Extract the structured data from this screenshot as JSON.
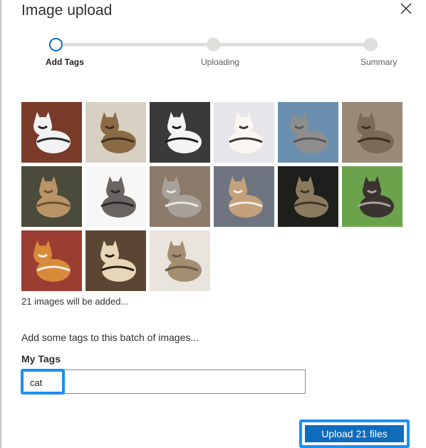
{
  "dialog": {
    "title": "Image upload"
  },
  "stepper": {
    "steps": [
      {
        "label": "Add Tags",
        "active": true
      },
      {
        "label": "Uploading",
        "active": false
      },
      {
        "label": "Summary",
        "active": false
      }
    ]
  },
  "images": {
    "count_text": "21 images will be added...",
    "thumbnails": [
      {
        "name": "thumb-1",
        "bg": "#7a3b2a",
        "fg": "#f2f2f2",
        "accent": "#2a2a2a"
      },
      {
        "name": "thumb-2",
        "bg": "#d8d0c2",
        "fg": "#8b6b45",
        "accent": "#3b2f23"
      },
      {
        "name": "thumb-3",
        "bg": "#3a3a3a",
        "fg": "#f4f4f4",
        "accent": "#1a1a1a"
      },
      {
        "name": "thumb-4",
        "bg": "#e5e5ea",
        "fg": "#fbf7f0",
        "accent": "#3a3a3a"
      },
      {
        "name": "thumb-5",
        "bg": "#6b8fae",
        "fg": "#8e8e8e",
        "accent": "#585858"
      },
      {
        "name": "thumb-6",
        "bg": "#9a8a78",
        "fg": "#7b6a55",
        "accent": "#3b3024"
      },
      {
        "name": "thumb-7",
        "bg": "#4a4b3a",
        "fg": "#b89466",
        "accent": "#6b5335"
      },
      {
        "name": "thumb-8",
        "bg": "#f7f7f7",
        "fg": "#6a6563",
        "accent": "#2b2a2a"
      },
      {
        "name": "thumb-9",
        "bg": "#8c7a6a",
        "fg": "#a7a19a",
        "accent": "#e9e6e1"
      },
      {
        "name": "thumb-10",
        "bg": "#6f7580",
        "fg": "#c4a17a",
        "accent": "#f1ede6"
      },
      {
        "name": "thumb-11",
        "bg": "#1d1f1d",
        "fg": "#8b7a5e",
        "accent": "#3b3528"
      },
      {
        "name": "thumb-12",
        "bg": "#6aa34c",
        "fg": "#3a3330",
        "accent": "#a9a39e"
      },
      {
        "name": "thumb-13",
        "bg": "#9a3e31",
        "fg": "#d88a3b",
        "accent": "#f6efe6"
      },
      {
        "name": "thumb-14",
        "bg": "#5b4634",
        "fg": "#e8d6b8",
        "accent": "#2a1d15"
      },
      {
        "name": "thumb-15",
        "bg": "#e9e4dd",
        "fg": "#a48e72",
        "accent": "#6a5846"
      }
    ]
  },
  "tags": {
    "prompt": "Add some tags to this batch of images...",
    "label": "My Tags",
    "current_tag": "cat"
  },
  "footer": {
    "upload_label": "Upload 21 files"
  }
}
